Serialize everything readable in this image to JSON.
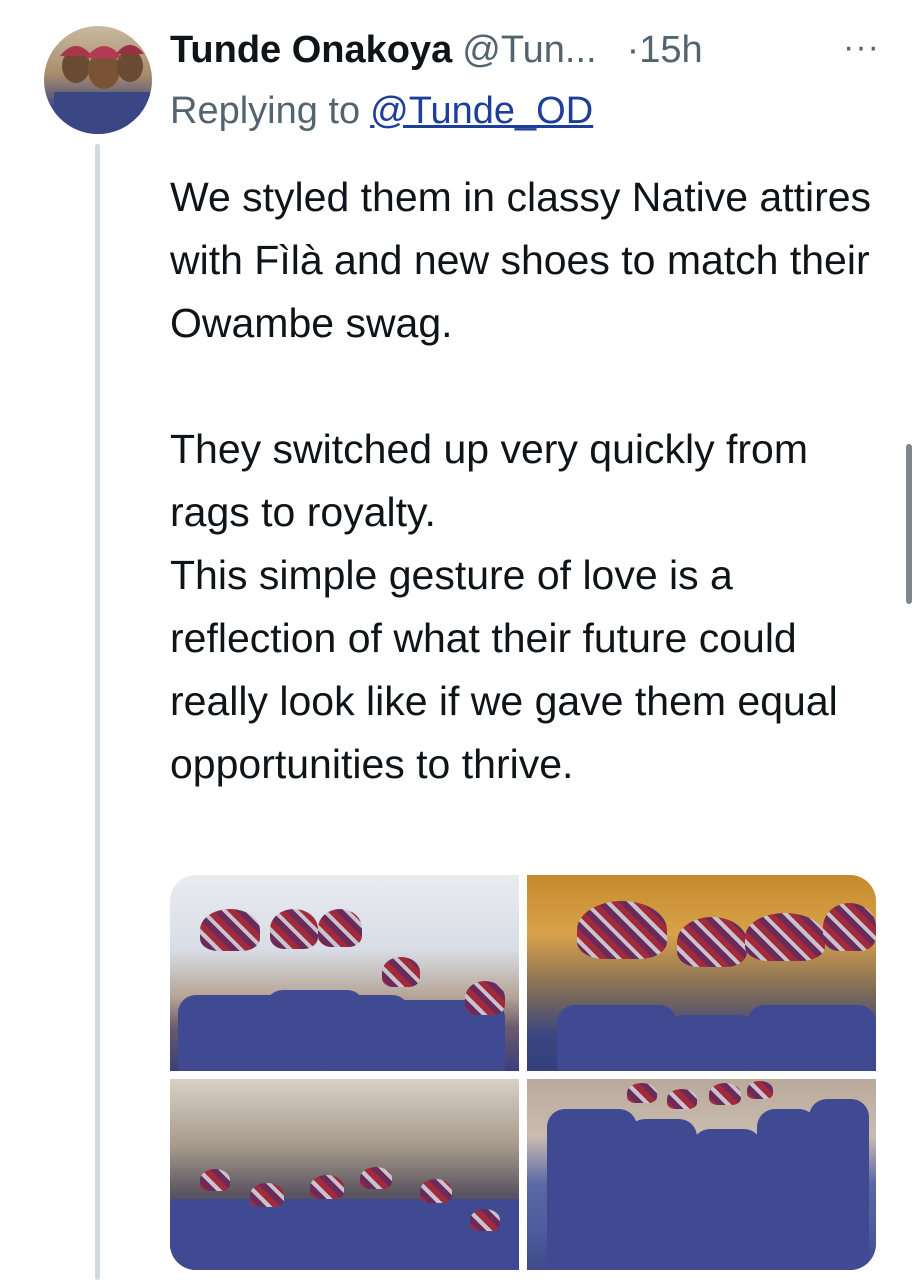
{
  "tweet": {
    "author_name": "Tunde Onakoya",
    "author_handle": "@Tun...",
    "timestamp": "·15h",
    "more_label": "···",
    "replying_prefix": "Replying to",
    "replying_handle": "@Tunde_OD",
    "paragraphs": [
      "We styled them in classy Native attires with Fìlà and new shoes to match their Owambe swag.",
      "They switched up very quickly from rags to royalty.",
      "This simple gesture of love is a reflection of what their future could really look like if we gave them equal opportunities to thrive."
    ]
  },
  "icons": {
    "avatar": "avatar",
    "more": "more-options-icon"
  },
  "colors": {
    "text_primary": "#0f1419",
    "text_secondary": "#536471",
    "mention": "#1d3e9b",
    "thread_line": "#cfd9de"
  }
}
